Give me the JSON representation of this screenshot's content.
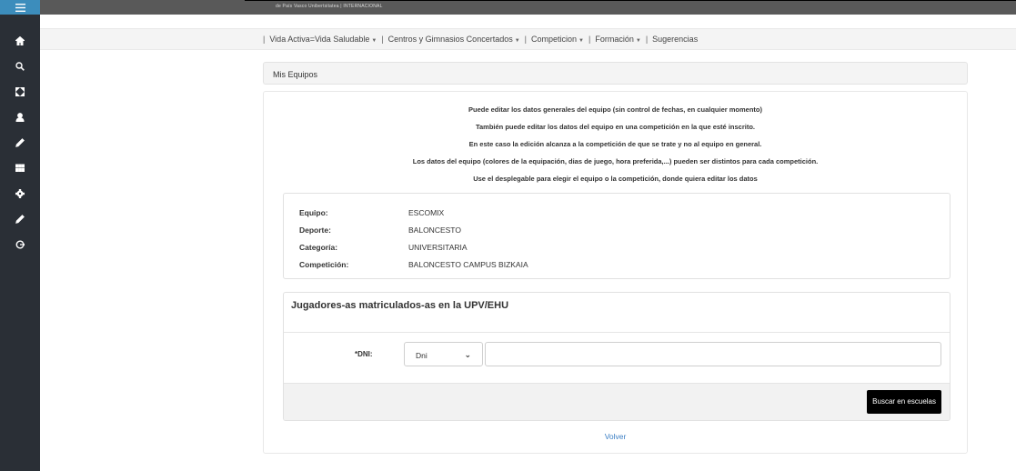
{
  "topbar": {
    "logo_text": "de País Vasco   Unibertsitatea    |   INTERNACIONAL"
  },
  "sidebar": {
    "icons": [
      "menu-icon",
      "home-icon",
      "search-icon",
      "expand-icon",
      "user-icon",
      "edit-icon",
      "grid-icon",
      "settings-icon",
      "pencil-icon",
      "logout-icon"
    ]
  },
  "nav": {
    "items": [
      {
        "label": "Vida Activa=Vida Saludable",
        "dropdown": true
      },
      {
        "label": "Centros y Gimnasios Concertados",
        "dropdown": true
      },
      {
        "label": "Competicion",
        "dropdown": true
      },
      {
        "label": "Formación",
        "dropdown": true
      },
      {
        "label": "Sugerencias",
        "dropdown": false
      }
    ],
    "separator": "|"
  },
  "panel": {
    "title": "Mis Equipos"
  },
  "info": {
    "lines": [
      "Puede editar los datos generales del equipo (sin control de fechas, en cualquier momento)",
      "También puede editar los datos del equipo en una competición en la que esté inscrito.",
      "En este caso la edición alcanza a la competición de que se trate y  no al equipo en general.",
      "Los datos del equipo (colores de la equipación, dias de juego, hora preferida,...) pueden ser distintos para cada competición.",
      "Use el desplegable para elegir el equipo o la competición, donde quiera editar los datos"
    ]
  },
  "team": {
    "rows": [
      {
        "label": "Equipo:",
        "value": "ESCOMIX"
      },
      {
        "label": "Deporte:",
        "value": "BALONCESTO"
      },
      {
        "label": "Categoría:",
        "value": "UNIVERSITARIA"
      },
      {
        "label": "Competición:",
        "value": "BALONCESTO CAMPUS BIZKAIA"
      }
    ]
  },
  "players": {
    "title": "Jugadores-as matriculados-as en la UPV/EHU",
    "dni_label": "*DNI:",
    "doc_type_selected": "Dni",
    "dni_value": "",
    "search_button": "Buscar en escuelas"
  },
  "back_link": "Volver",
  "colors": {
    "sidebar": "#2a2f36",
    "sidebar_top": "#3c8dbc",
    "link": "#3c7fc4",
    "button": "#000000"
  }
}
